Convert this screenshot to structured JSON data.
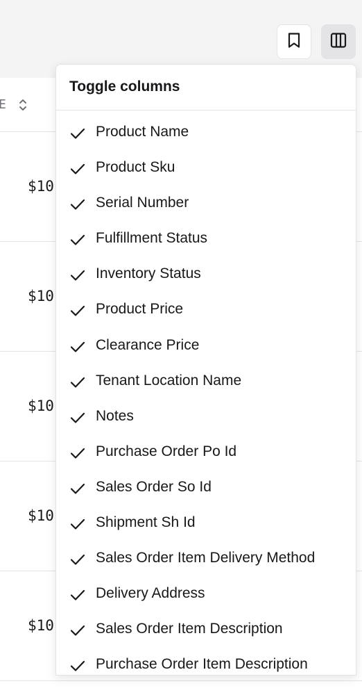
{
  "toolbar": {
    "bookmark_icon": "bookmark-icon",
    "columns_icon": "columns-icon"
  },
  "table": {
    "header_label": "E",
    "rows": [
      {
        "price": "$10"
      },
      {
        "price": "$10"
      },
      {
        "price": "$10"
      },
      {
        "price": "$10"
      },
      {
        "price": "$10"
      }
    ]
  },
  "column_menu": {
    "title": "Toggle columns",
    "items": [
      {
        "label": "Product Name",
        "checked": true
      },
      {
        "label": "Product Sku",
        "checked": true
      },
      {
        "label": "Serial Number",
        "checked": true
      },
      {
        "label": "Fulfillment Status",
        "checked": true
      },
      {
        "label": "Inventory Status",
        "checked": true
      },
      {
        "label": "Product Price",
        "checked": true
      },
      {
        "label": "Clearance Price",
        "checked": true
      },
      {
        "label": "Tenant Location Name",
        "checked": true
      },
      {
        "label": "Notes",
        "checked": true
      },
      {
        "label": "Purchase Order Po Id",
        "checked": true
      },
      {
        "label": "Sales Order So Id",
        "checked": true
      },
      {
        "label": "Shipment Sh Id",
        "checked": true
      },
      {
        "label": "Sales Order Item Delivery Method",
        "checked": true
      },
      {
        "label": "Delivery Address",
        "checked": true
      },
      {
        "label": "Sales Order Item Description",
        "checked": true
      },
      {
        "label": "Purchase Order Item Description",
        "checked": true
      }
    ]
  },
  "colors": {
    "background": "#ffffff",
    "topbar": "#f4f4f5",
    "border": "#e4e4e7",
    "text": "#18181b",
    "muted": "#71717a"
  }
}
